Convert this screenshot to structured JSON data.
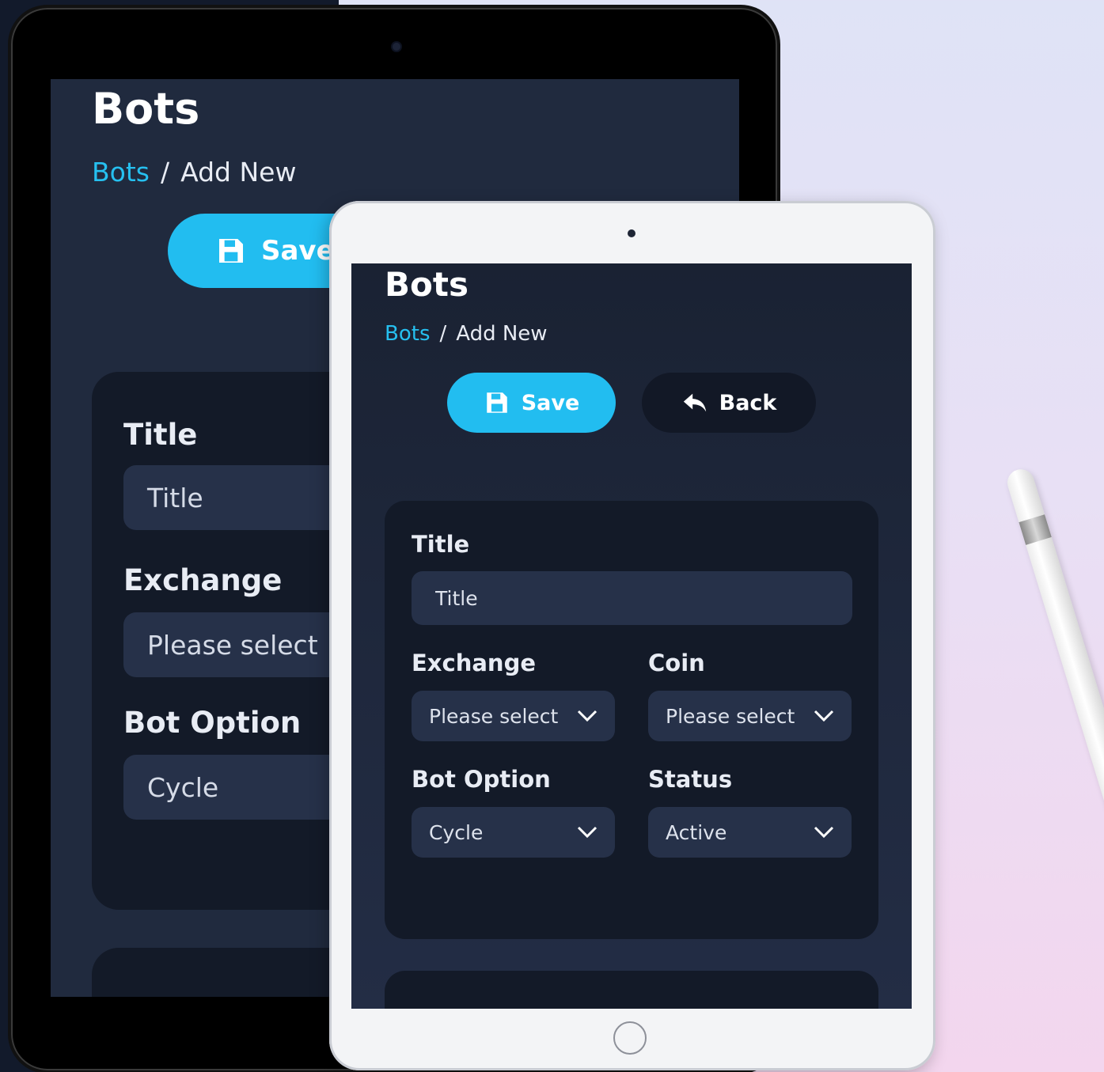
{
  "colors": {
    "accent": "#22bdf0",
    "card": "#131a28",
    "field": "#263149",
    "screen_bg": "#202a3e",
    "back_button": "#121826"
  },
  "back_device": {
    "title": "Bots",
    "breadcrumb": {
      "link": "Bots",
      "separator": "/",
      "current": "Add New"
    },
    "save_label": "Save",
    "fields": [
      {
        "label": "Title",
        "value": "Title"
      },
      {
        "label": "Exchange",
        "value": "Please select"
      },
      {
        "label": "Bot Option",
        "value": "Cycle"
      }
    ]
  },
  "front_device": {
    "title": "Bots",
    "breadcrumb": {
      "link": "Bots",
      "separator": "/",
      "current": "Add New"
    },
    "toolbar": {
      "save_label": "Save",
      "save_icon": "floppy-disk-icon",
      "back_label": "Back",
      "back_icon": "reply-arrow-icon"
    },
    "form": {
      "title_label": "Title",
      "title_placeholder": "Title",
      "exchange_label": "Exchange",
      "exchange_value": "Please select",
      "coin_label": "Coin",
      "coin_value": "Please select",
      "bot_option_label": "Bot Option",
      "bot_option_value": "Cycle",
      "status_label": "Status",
      "status_value": "Active"
    }
  }
}
